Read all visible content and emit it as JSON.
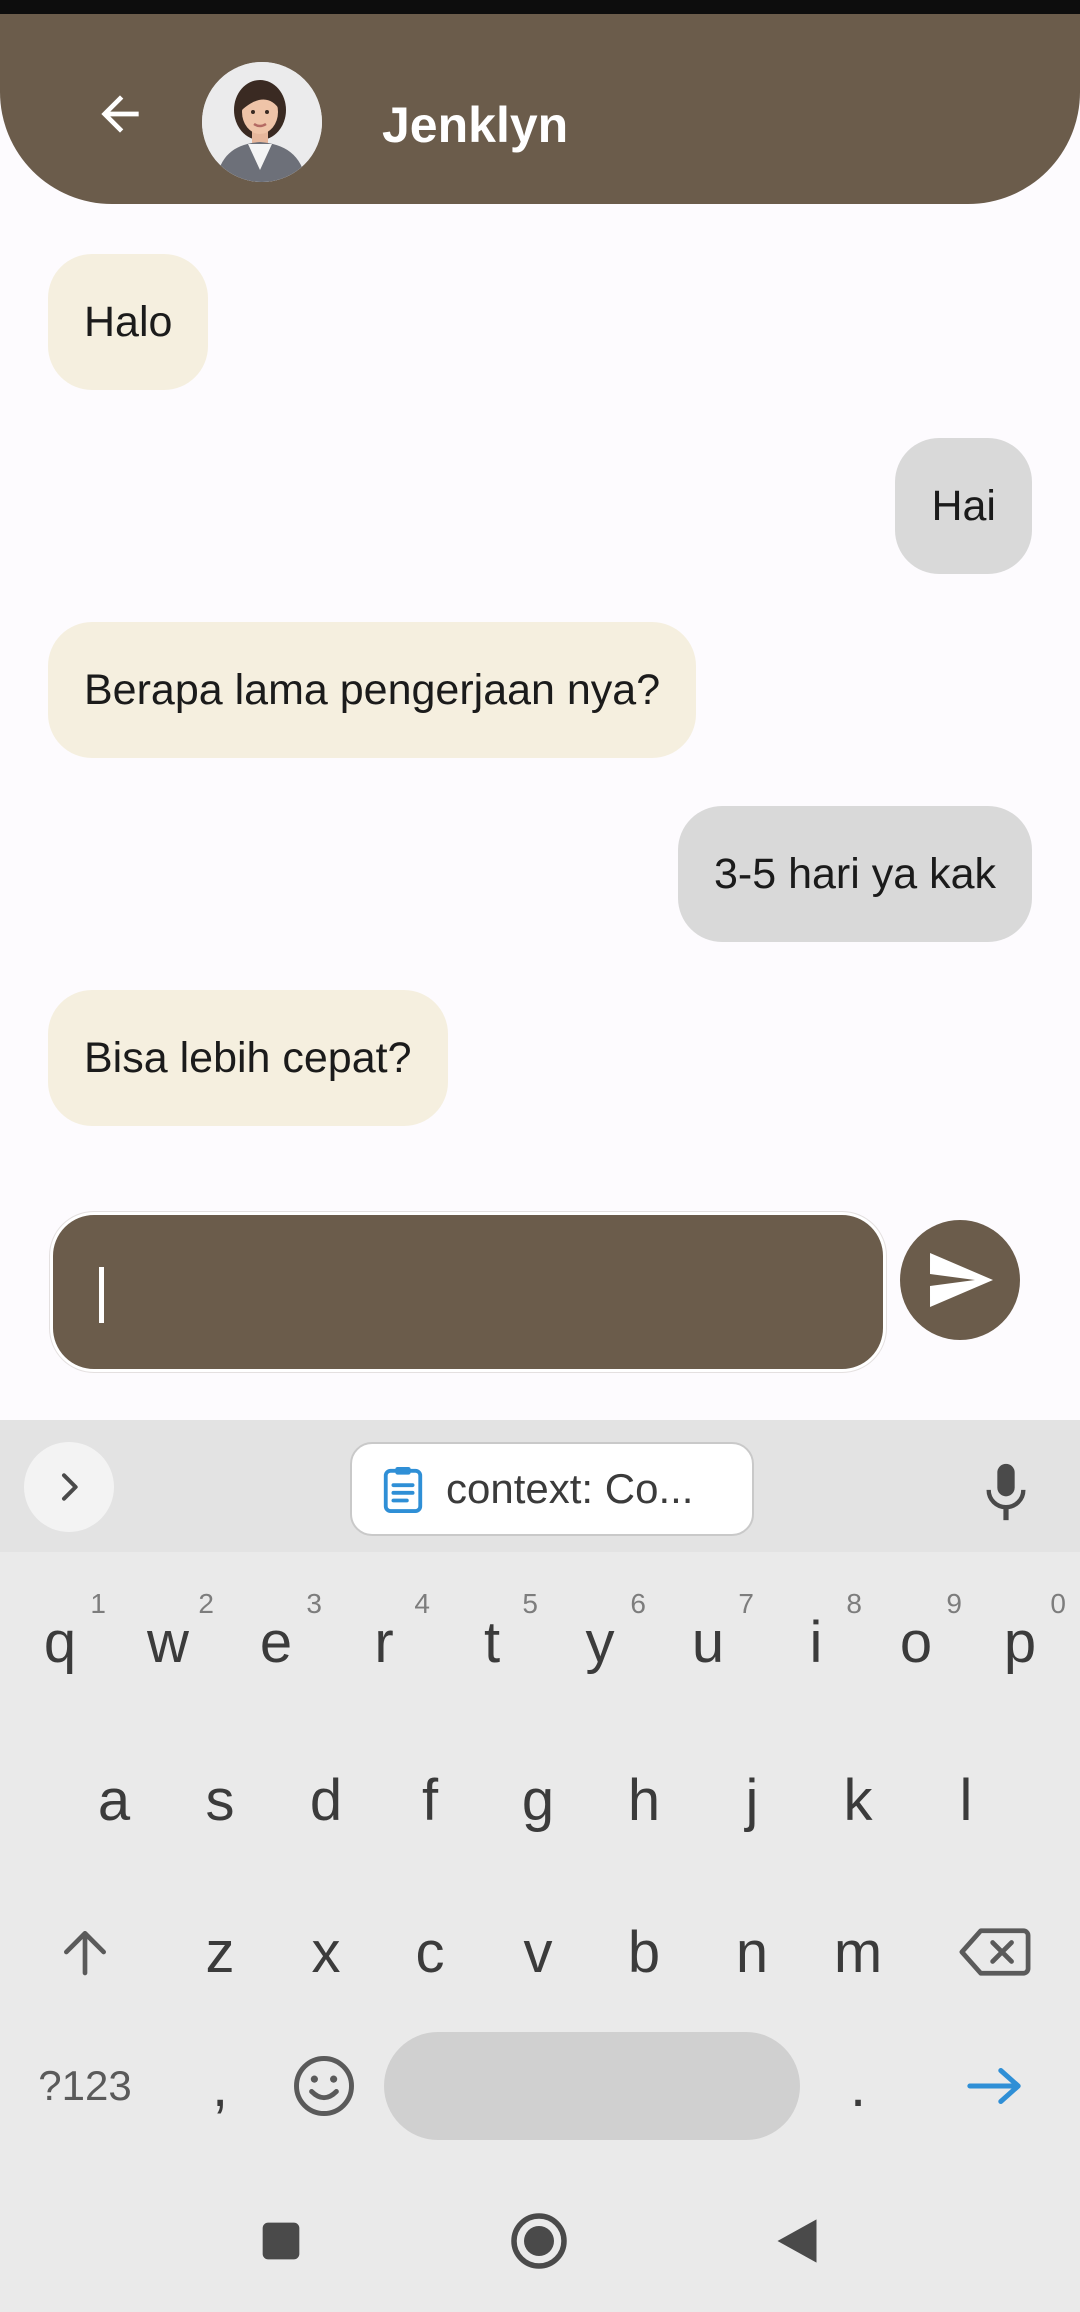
{
  "header": {
    "contact_name": "Jenklyn",
    "background_color": "#6b5c4b",
    "back_icon": "arrow-left-icon",
    "avatar": "contact-avatar"
  },
  "messages": [
    {
      "direction": "incoming",
      "text": "Halo"
    },
    {
      "direction": "outgoing",
      "text": "Hai"
    },
    {
      "direction": "incoming",
      "text": "Berapa lama pengerjaan nya?"
    },
    {
      "direction": "outgoing",
      "text": "3-5 hari ya kak"
    },
    {
      "direction": "incoming",
      "text": "Bisa lebih cepat?"
    }
  ],
  "colors": {
    "incoming_bubble": "#f5efdf",
    "outgoing_bubble": "#d9d9d9",
    "accent": "#6b5c4b",
    "keyboard_action": "#2f8fd6"
  },
  "composer": {
    "value": "",
    "placeholder": "",
    "send_icon": "send-icon"
  },
  "keyboard": {
    "toolbar": {
      "expand_icon": "chevron-right-icon",
      "clipboard_icon": "clipboard-icon",
      "clipboard_chip": "context: Co...",
      "mic_icon": "microphone-icon"
    },
    "row1": [
      {
        "key": "q",
        "hint": "1"
      },
      {
        "key": "w",
        "hint": "2"
      },
      {
        "key": "e",
        "hint": "3"
      },
      {
        "key": "r",
        "hint": "4"
      },
      {
        "key": "t",
        "hint": "5"
      },
      {
        "key": "y",
        "hint": "6"
      },
      {
        "key": "u",
        "hint": "7"
      },
      {
        "key": "i",
        "hint": "8"
      },
      {
        "key": "o",
        "hint": "9"
      },
      {
        "key": "p",
        "hint": "0"
      }
    ],
    "row2": [
      "a",
      "s",
      "d",
      "f",
      "g",
      "h",
      "j",
      "k",
      "l"
    ],
    "row3": [
      "z",
      "x",
      "c",
      "v",
      "b",
      "n",
      "m"
    ],
    "row4": {
      "symbols": "?123",
      "comma": ",",
      "period": "."
    },
    "icons": {
      "shift": "shift-icon",
      "backspace": "backspace-icon",
      "emoji": "emoji-icon",
      "enter": "enter-arrow-icon"
    }
  },
  "navbar": {
    "recents_icon": "square-icon",
    "home_icon": "home-circle-icon",
    "back_icon": "triangle-back-icon"
  }
}
